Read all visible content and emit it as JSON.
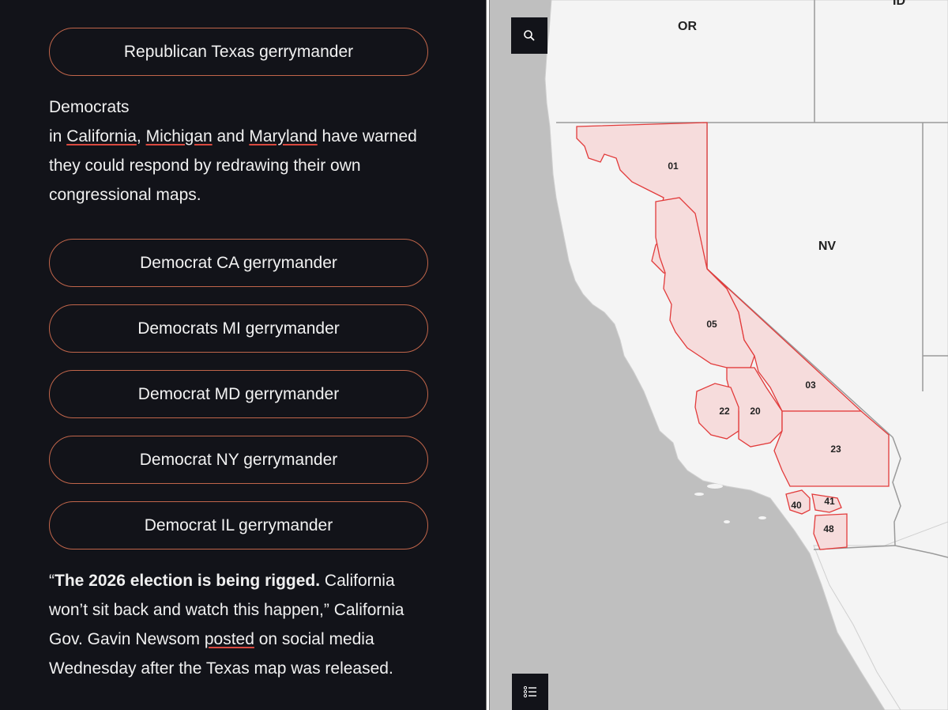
{
  "buttons": {
    "texas": "Republican Texas gerrymander",
    "ca": "Democrat CA gerrymander",
    "mi": "Democrats MI gerrymander",
    "md": "Democrat MD gerrymander",
    "ny": "Democrat NY gerrymander",
    "il": "Democrat IL gerrymander"
  },
  "paragraph1": {
    "line1": "Democrats",
    "in": "in ",
    "link_california": "California",
    "comma": ", ",
    "link_michigan": "Michigan",
    "and": " and ",
    "link_maryland": "Maryland",
    "rest": " have warned they could respond by redrawing their own congressional maps."
  },
  "paragraph2": {
    "open_quote": "“",
    "bold": "The 2026 election is being rigged.",
    "text1": " California won’t sit back and watch this happen,” California Gov. Gavin Newsom ",
    "link_posted": "posted",
    "text2": " on social media Wednesday after the Texas map was released."
  },
  "map": {
    "states": {
      "or": "OR",
      "id": "ID",
      "nv": "NV"
    },
    "districts": [
      "01",
      "05",
      "03",
      "22",
      "20",
      "23",
      "40",
      "41",
      "48"
    ],
    "district_fill": "#f6dcdc",
    "district_stroke": "#e23b3b",
    "land_color": "#f4f4f4",
    "ocean_color": "#bfbfbf",
    "search_icon": "search-icon",
    "legend_icon": "list-icon"
  }
}
